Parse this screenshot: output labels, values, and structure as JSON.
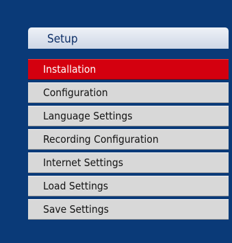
{
  "setup_menu": {
    "title": "Setup",
    "items": [
      {
        "label": "Installation",
        "selected": true
      },
      {
        "label": "Configuration",
        "selected": false
      },
      {
        "label": "Language Settings",
        "selected": false
      },
      {
        "label": "Recording Configuration",
        "selected": false
      },
      {
        "label": "Internet Settings",
        "selected": false
      },
      {
        "label": "Load Settings",
        "selected": false
      },
      {
        "label": "Save Settings",
        "selected": false
      }
    ]
  },
  "colors": {
    "background": "#0a3a78",
    "header": "#dfe5ef",
    "item": "#d8d8d8",
    "selected_item": "#d4000f"
  }
}
